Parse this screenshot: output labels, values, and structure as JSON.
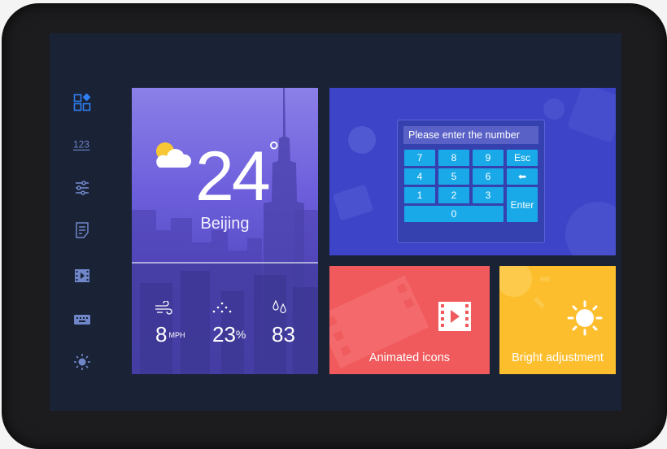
{
  "sidebar": {
    "items": [
      {
        "icon": "apps-grid-icon"
      },
      {
        "icon": "numbers-123-icon"
      },
      {
        "icon": "sliders-icon"
      },
      {
        "icon": "document-icon"
      },
      {
        "icon": "film-icon"
      },
      {
        "icon": "keyboard-icon"
      },
      {
        "icon": "brightness-icon"
      }
    ]
  },
  "weather": {
    "temperature": "24",
    "degree_symbol": "°",
    "city": "Beijing",
    "wind_value": "8",
    "wind_unit": "MPH",
    "humidity_value": "23",
    "humidity_unit": "%",
    "rain_value": "83"
  },
  "keypad": {
    "placeholder": "Please enter the number",
    "keys": {
      "k7": "7",
      "k8": "8",
      "k9": "9",
      "esc": "Esc",
      "k4": "4",
      "k5": "5",
      "k6": "6",
      "backspace": "⬅",
      "k1": "1",
      "k2": "2",
      "k3": "3",
      "enter": "Enter",
      "k0": "0"
    }
  },
  "tiles": {
    "animated_label": "Animated icons",
    "bright_label": "Bright adjustment"
  },
  "colors": {
    "screen_bg": "#1a2236",
    "weather_tile": "#6e60dc",
    "keypad_tile": "#3d44c8",
    "key": "#19a9e8",
    "animated_tile": "#f05a5c",
    "bright_tile": "#fdbe2e",
    "sidebar_icon": "#6f86c9",
    "sidebar_active": "#2f7ff2"
  }
}
